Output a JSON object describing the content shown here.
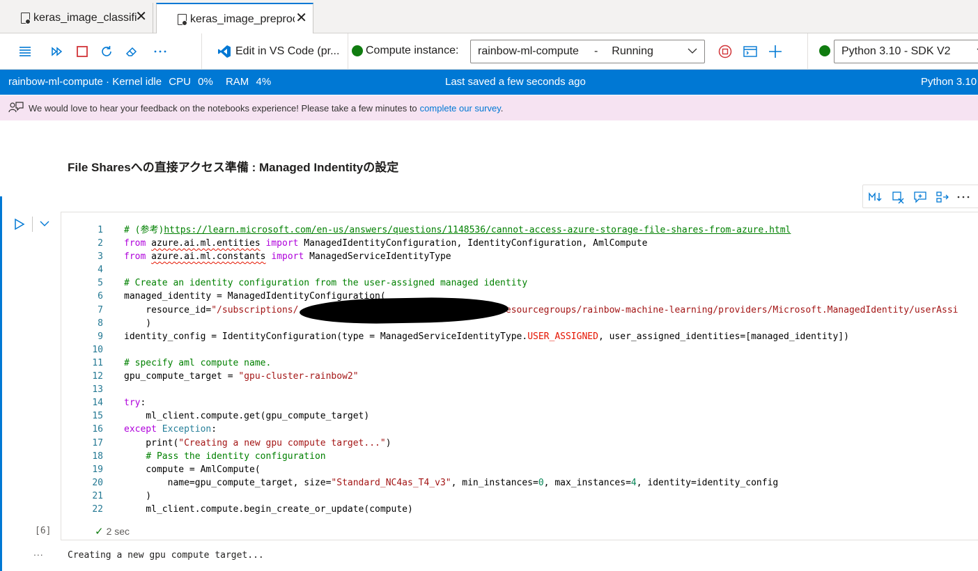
{
  "tabs": [
    {
      "label": "keras_image_classifica",
      "active": false
    },
    {
      "label": "keras_image_preproc",
      "active": true
    }
  ],
  "toolbar": {
    "vscode_label": "Edit in VS Code (pr...",
    "compute_label": "Compute instance:",
    "compute_name": "rainbow-ml-compute",
    "compute_sep": "-",
    "compute_state": "Running",
    "kernel_label": "Python 3.10 - SDK V2"
  },
  "status": {
    "left": [
      "rainbow-ml-compute · Kernel idle",
      "CPU",
      "0%",
      "RAM",
      "4%"
    ],
    "center": "Last saved a few seconds ago",
    "right": "Python 3.10"
  },
  "feedback": {
    "text": "We would love to hear your feedback on the notebooks experience! Please take a few minutes to",
    "link": "complete our survey",
    "end": "."
  },
  "heading": "File Sharesへの直接アクセス準備 : Managed Indentityの設定",
  "cell": {
    "execution_count": "[6]",
    "duration": "2 sec",
    "output": "Creating a new gpu compute target...",
    "output_marker": "..."
  },
  "colors": {
    "accent": "#0078d4",
    "status_bar": "#0078d4",
    "feedback_bg": "#f6e3f2",
    "running": "#107c10",
    "stop": "#d13438"
  }
}
